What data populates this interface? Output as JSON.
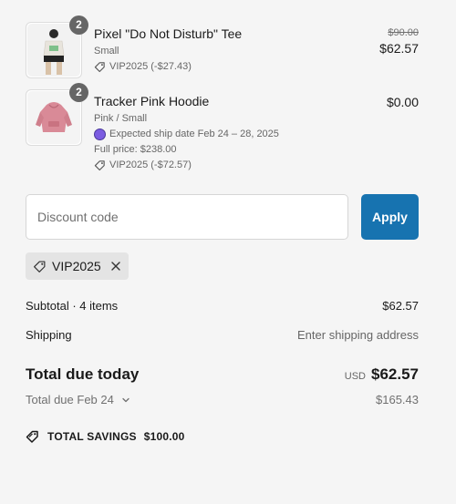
{
  "items": [
    {
      "quantity": "2",
      "name": "Pixel \"Do Not Disturb\" Tee",
      "variant": "Small",
      "discount": "VIP2025 (-$27.43)",
      "original_price": "$90.00",
      "price": "$62.57"
    },
    {
      "quantity": "2",
      "name": "Tracker Pink Hoodie",
      "variant": "Pink / Small",
      "ship_note": "Expected ship date Feb 24 – 28, 2025",
      "full_price": "Full price: $238.00",
      "discount": "VIP2025 (-$72.57)",
      "price": "$0.00"
    }
  ],
  "discount": {
    "placeholder": "Discount code",
    "apply_label": "Apply",
    "applied_code": "VIP2025"
  },
  "totals": {
    "subtotal_label": "Subtotal · 4 items",
    "subtotal_value": "$62.57",
    "shipping_label": "Shipping",
    "shipping_value": "Enter shipping address",
    "due_today_label": "Total due today",
    "currency": "USD",
    "due_today_value": "$62.57",
    "due_later_label": "Total due Feb 24",
    "due_later_value": "$165.43",
    "savings_label": "TOTAL SAVINGS",
    "savings_value": "$100.00"
  },
  "colors": {
    "accent": "#1773b0",
    "background": "#f5f5f5",
    "ship_dot": "#7b5ce1"
  }
}
